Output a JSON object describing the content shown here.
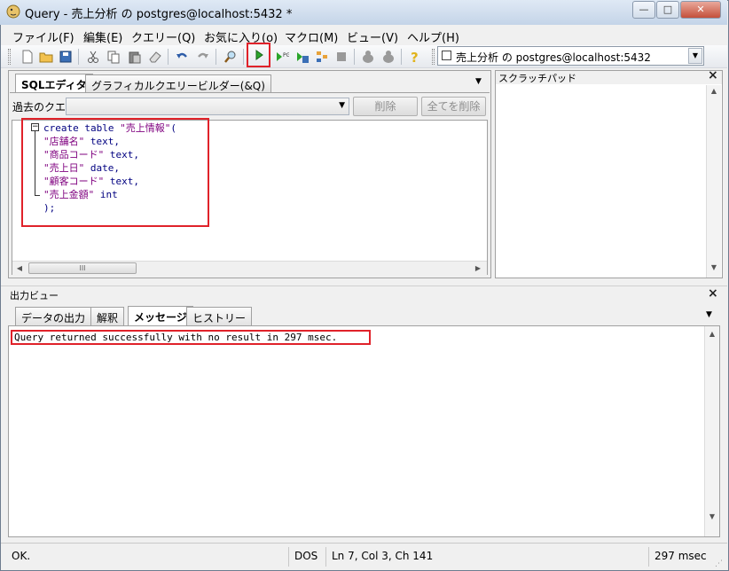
{
  "window": {
    "title": "Query - 売上分析 の postgres@localhost:5432 *",
    "btn_min": "—",
    "btn_max": "□",
    "btn_close": "✕"
  },
  "menu": [
    "ファイル(F)",
    "編集(E)",
    "クエリー(Q)",
    "お気に入り(o)",
    "マクロ(M)",
    "ビュー(V)",
    "ヘルプ(H)"
  ],
  "toolbar": {
    "icons": [
      "new-file",
      "open",
      "save",
      "cut",
      "copy",
      "paste",
      "clear",
      "undo",
      "redo",
      "find",
      "execute",
      "explain",
      "execute-to-file",
      "explain-analyze",
      "cancel",
      "vacuum",
      "pgscript",
      "help"
    ],
    "connection": "売上分析 の postgres@localhost:5432"
  },
  "sql_panel": {
    "tabs": [
      "SQLエディタ",
      "グラフィカルクエリービルダー(&Q)"
    ],
    "history_label": "過去のクエリ",
    "delete_btn": "削除",
    "delete_all_btn": "全てを削除",
    "code": [
      {
        "kw": "create table ",
        "str": "\"売上情報\"",
        "rest": "("
      },
      {
        "kw": "",
        "str": "\"店舗名\"",
        "rest": " text,"
      },
      {
        "kw": "",
        "str": "\"商品コード\"",
        "rest": " text,"
      },
      {
        "kw": "",
        "str": "\"売上日\"",
        "rest": " date,"
      },
      {
        "kw": "",
        "str": "\"顧客コード\"",
        "rest": " text,"
      },
      {
        "kw": "",
        "str": "\"売上金額\"",
        "rest": " int"
      },
      {
        "kw": ");",
        "str": "",
        "rest": ""
      }
    ],
    "hscroll_thumb": "III"
  },
  "scratch": {
    "title": "スクラッチパッド"
  },
  "output": {
    "title": "出力ビュー",
    "tabs": [
      "データの出力",
      "解釈",
      "メッセージ",
      "ヒストリー"
    ],
    "message": "Query returned successfully with no result in 297 msec."
  },
  "status": {
    "state": "OK.",
    "encoding": "DOS",
    "position": "Ln 7, Col 3, Ch 141",
    "duration": "297 msec"
  },
  "colors": {
    "highlight": "#e0222a",
    "keyword": "#000080",
    "string": "#7f007f"
  }
}
